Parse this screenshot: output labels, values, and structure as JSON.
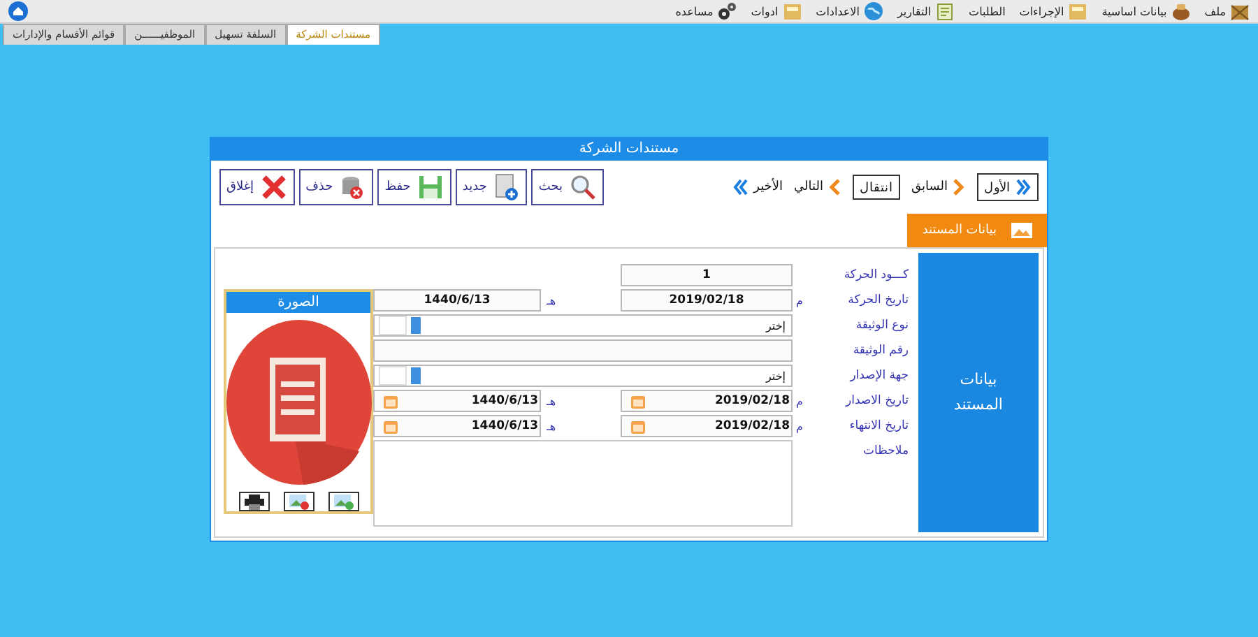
{
  "menu": [
    {
      "label": "ملف"
    },
    {
      "label": "بيانات اساسية"
    },
    {
      "label": "الإجراءات"
    },
    {
      "label": "الطلبات"
    },
    {
      "label": "التقارير"
    },
    {
      "label": "الاعدادات"
    },
    {
      "label": "ادوات"
    },
    {
      "label": "مساعده"
    }
  ],
  "tabs": [
    {
      "label": "مستندات الشركة",
      "selected": true
    },
    {
      "label": "السلفة تسهيل",
      "selected": false
    },
    {
      "label": "الموظفيــــــن",
      "selected": false
    },
    {
      "label": "قوائم الأقسام والإدارات",
      "selected": false
    }
  ],
  "dialog": {
    "title": "مستندات الشركة",
    "nav": [
      {
        "kind": "first",
        "label": "الأول"
      },
      {
        "kind": "prev",
        "label": "السابق"
      },
      {
        "kind": "goto",
        "label": "انتقال"
      },
      {
        "kind": "next",
        "label": "التالي"
      },
      {
        "kind": "last",
        "label": "الأخير"
      }
    ],
    "actions": [
      {
        "kind": "search",
        "label": "بحث"
      },
      {
        "kind": "new",
        "label": "جديد"
      },
      {
        "kind": "save",
        "label": "حفظ"
      },
      {
        "kind": "delete",
        "label": "حذف"
      },
      {
        "kind": "close",
        "label": "إغلاق"
      }
    ],
    "section_tab": "بيانات المستند",
    "side_panel": "بيانات المستند",
    "fields": [
      {
        "kind": "text",
        "label": "كـــود الحركة",
        "value": "1"
      },
      {
        "kind": "date",
        "label": "تاريخ الحركة",
        "value": "2019/02/18",
        "unit": "م",
        "hijri_value": "1440/6/13",
        "hijri_unit": "هـ"
      },
      {
        "kind": "select",
        "label": "نوع الوثيقة",
        "value": "إختر"
      },
      {
        "kind": "text_wide",
        "label": "رقم الوثيقة"
      },
      {
        "kind": "select",
        "label": "جهة الإصدار",
        "value": "إختر"
      },
      {
        "kind": "date_picker",
        "label": "تاريخ الاصدار",
        "value": "2019/02/18",
        "unit": "م",
        "hijri_value": "1440/6/13",
        "hijri_unit": "هـ"
      },
      {
        "kind": "date_picker",
        "label": "تاريخ الانتهاء",
        "value": "2019/02/18",
        "unit": "م",
        "hijri_value": "1440/6/13",
        "hijri_unit": "هـ"
      },
      {
        "kind": "textarea",
        "label": "ملاحظات"
      }
    ],
    "image_panel": {
      "title": "الصورة"
    }
  }
}
